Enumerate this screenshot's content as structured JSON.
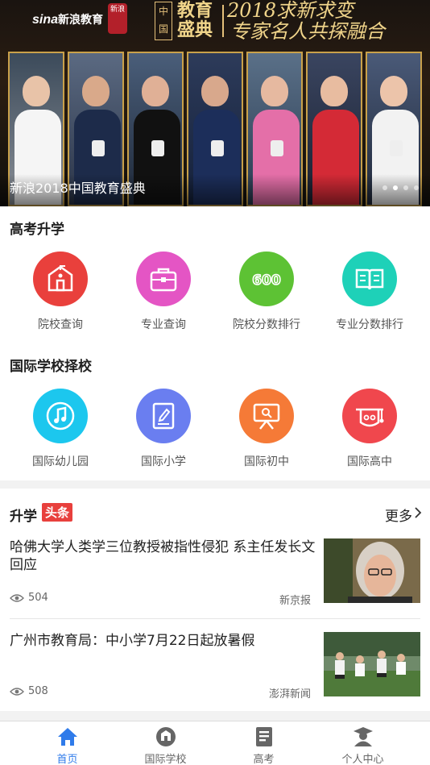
{
  "banner": {
    "logo_brand": "sina",
    "logo_text": "新浪教育",
    "seal_text": "新浪",
    "event_mark": "中国",
    "event_title_line1": "教育",
    "event_title_line2": "盛典",
    "slogan_line1": "2018求新求变",
    "slogan_line2": "专家名人共探融合",
    "caption": "新浪2018中国教育盛典",
    "slide_count": 4,
    "active_slide": 2
  },
  "gaokao": {
    "title": "高考升学",
    "items": [
      {
        "label": "院校查询",
        "icon": "school-building-icon",
        "color": "#e9403c"
      },
      {
        "label": "专业查询",
        "icon": "briefcase-icon",
        "color": "#e455c4"
      },
      {
        "label": "院校分数排行",
        "icon": "score-600-icon",
        "color": "#5dc234"
      },
      {
        "label": "专业分数排行",
        "icon": "book-icon",
        "color": "#1ed1b8"
      }
    ]
  },
  "intl": {
    "title": "国际学校择校",
    "items": [
      {
        "label": "国际幼儿园",
        "icon": "music-note-icon",
        "color": "#1cc7ee"
      },
      {
        "label": "国际小学",
        "icon": "notebook-pen-icon",
        "color": "#6a7ef0"
      },
      {
        "label": "国际初中",
        "icon": "presentation-board-icon",
        "color": "#f57a37"
      },
      {
        "label": "国际高中",
        "icon": "graduation-cap-icon",
        "color": "#f0474d"
      }
    ]
  },
  "news": {
    "title_a": "升学",
    "title_b": "头条",
    "more": "更多",
    "items": [
      {
        "title": "哈佛大学人类学三位教授被指性侵犯 系主任发长文回应",
        "views": "504",
        "source": "新京报"
      },
      {
        "title": "广州市教育局：中小学7月22日起放暑假",
        "views": "508",
        "source": "澎湃新闻"
      }
    ]
  },
  "tabbar": {
    "active": 0,
    "items": [
      {
        "label": "首页",
        "icon": "home-icon"
      },
      {
        "label": "国际学校",
        "icon": "badge-icon"
      },
      {
        "label": "高考",
        "icon": "document-icon"
      },
      {
        "label": "个人中心",
        "icon": "user-graduate-icon"
      }
    ]
  },
  "colors": {
    "accent": "#2f7bea",
    "headline_tag": "#e8403d",
    "banner_gold": "#f0d48a"
  }
}
